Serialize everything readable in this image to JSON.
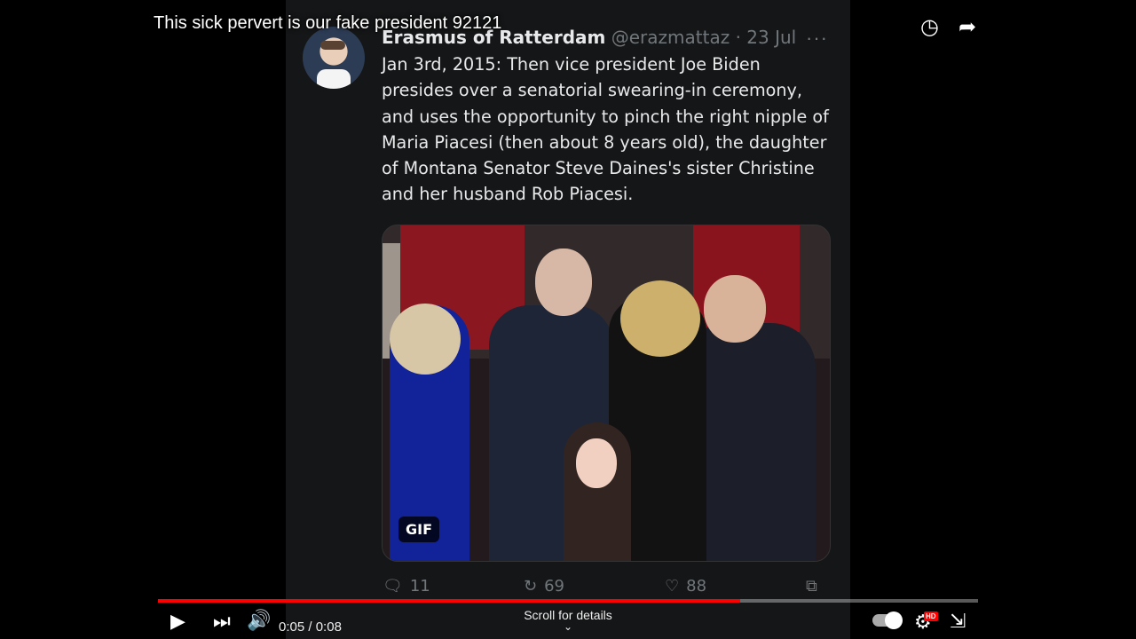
{
  "video": {
    "title": "This sick pervert is our fake president 92121",
    "time_current": "0:05",
    "time_separator": "/",
    "time_total": "0:08",
    "progress_fraction": 0.71,
    "scroll_hint": "Scroll for details",
    "icons": {
      "watch_later": "clock-icon",
      "share": "share-arrow-icon",
      "play": "play-icon",
      "next": "next-icon",
      "volume": "volume-icon",
      "autoplay": "autoplay-toggle-icon",
      "settings": "gear-icon",
      "fullscreen_exit": "exit-fullscreen-icon"
    },
    "settings_badge": "HD",
    "colors": {
      "progress": "#ff0000",
      "background": "#000000"
    }
  },
  "tweet": {
    "author_name": "Erasmus of Ratterdam",
    "handle": "@erazmattaz",
    "separator": "·",
    "date": "23 Jul",
    "more": "···",
    "text": "Jan 3rd, 2015: Then vice president Joe Biden\npresides over a senatorial swearing-in ceremony,\nand uses the opportunity to pinch the right nipple of\nMaria Piacesi (then about 8 years old), the daughter\nof Montana Senator Steve Daines's sister Christine\nand her husband Rob Piacesi.",
    "media_badge": "GIF",
    "replies": "11",
    "retweets": "69",
    "likes": "88",
    "colors": {
      "panel": "#151617",
      "muted": "#71767b",
      "text": "#e7e9ea"
    }
  }
}
